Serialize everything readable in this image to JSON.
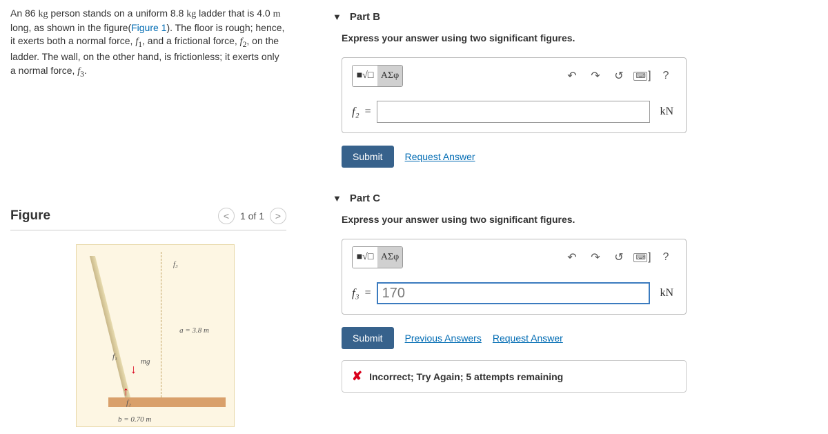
{
  "problem": {
    "text_segments": [
      "An 86 ",
      "kg",
      " person stands on a uniform 8.8 ",
      "kg",
      " ladder that is 4.0 ",
      "m",
      " long, as shown in the figure(",
      "Figure 1",
      "). The floor is rough; hence, it exerts both a normal force, ",
      "f",
      "1",
      ", and a frictional force, ",
      "f",
      "2",
      ", on the ladder. The wall, on the other hand, is frictionless; it exerts only a normal force, ",
      "f",
      "3",
      "."
    ]
  },
  "figure": {
    "title": "Figure",
    "counter": "1 of 1",
    "labels": {
      "a": "a = 3.8 m",
      "b": "b = 0.70 m",
      "f1": "f₁",
      "f2": "f₂",
      "f3": "f₃",
      "mg": "mg"
    }
  },
  "toolbar": {
    "template_label": "■√□",
    "greek_label": "ΑΣφ",
    "help_label": "?"
  },
  "parts": {
    "b": {
      "title": "Part B",
      "instruction": "Express your answer using two significant figures.",
      "variable": "f₂",
      "eq": "=",
      "value": "",
      "unit": "kN",
      "submit": "Submit",
      "request": "Request Answer"
    },
    "c": {
      "title": "Part C",
      "instruction": "Express your answer using two significant figures.",
      "variable": "f₃",
      "eq": "=",
      "value": "170",
      "unit": "kN",
      "submit": "Submit",
      "previous": "Previous Answers",
      "request": "Request Answer",
      "feedback": "Incorrect; Try Again; 5 attempts remaining"
    }
  }
}
